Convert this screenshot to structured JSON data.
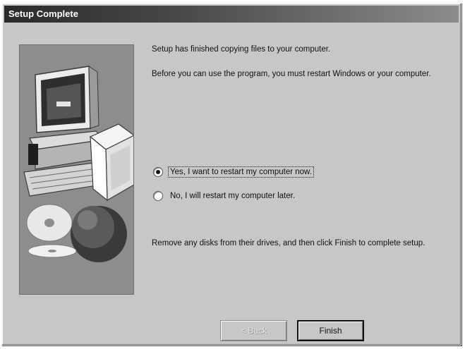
{
  "window": {
    "title": "Setup Complete"
  },
  "content": {
    "message_copied": "Setup has finished copying files to your computer.",
    "message_restart": "Before you can use the program, you must restart Windows or your computer.",
    "message_remove": "Remove any disks from their drives, and then click Finish to complete setup."
  },
  "options": {
    "restart_now": {
      "label": "Yes, I want to restart my computer now.",
      "selected": true
    },
    "restart_later": {
      "label": "No, I will restart my computer later.",
      "selected": false
    }
  },
  "buttons": {
    "back": {
      "label": "< Back",
      "enabled": false
    },
    "finish": {
      "label": "Finish",
      "enabled": true
    }
  },
  "colors": {
    "dialog_face": "#c7c7c7",
    "titlebar_start": "#2a2a2a",
    "titlebar_end": "#8c8c8c",
    "art_panel": "#8d8d8d"
  }
}
